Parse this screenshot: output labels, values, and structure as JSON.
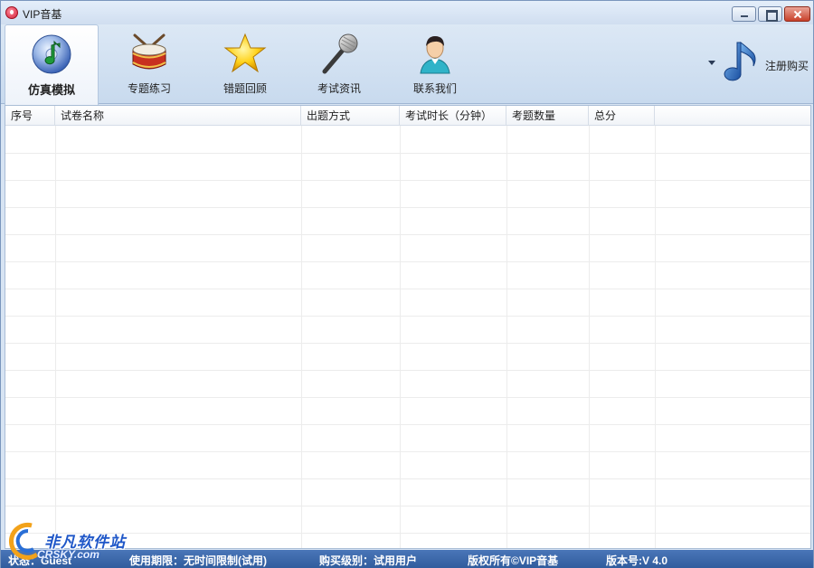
{
  "window": {
    "title": "VIP音基"
  },
  "toolbar": {
    "items": [
      {
        "label": "仿真模拟",
        "icon": "cd-music-icon",
        "active": true
      },
      {
        "label": "专题练习",
        "icon": "drum-icon",
        "active": false
      },
      {
        "label": "错题回顾",
        "icon": "star-icon",
        "active": false
      },
      {
        "label": "考试资讯",
        "icon": "microphone-icon",
        "active": false
      },
      {
        "label": "联系我们",
        "icon": "person-icon",
        "active": false
      }
    ],
    "register_label": "注册购买"
  },
  "table": {
    "columns": [
      "序号",
      "试卷名称",
      "出题方式",
      "考试时长（分钟）",
      "考题数量",
      "总分"
    ],
    "rows": []
  },
  "statusbar": {
    "status_prefix": "状态：",
    "status_value": "Guest",
    "usage_limit": "使用期限：无时间限制(试用)",
    "purchase_level": "购买级别：试用用户",
    "copyright": "版权所有©VIP音基",
    "version": "版本号:V 4.0"
  },
  "watermark": {
    "text": "非凡软件站",
    "sub": "CRSKY.com"
  },
  "colors": {
    "statusbar": "#3464a8",
    "toolbar_bg": "#d0e0f1",
    "accent": "#1f57c8"
  }
}
